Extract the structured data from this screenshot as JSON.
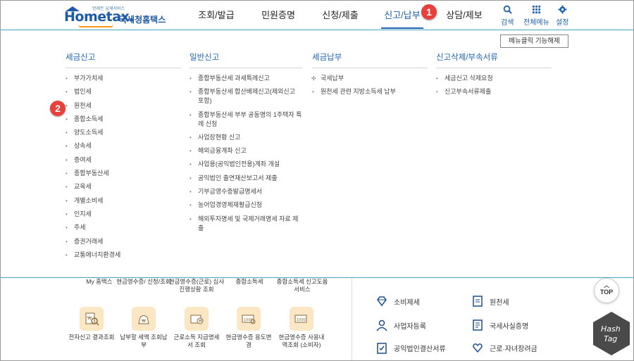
{
  "header": {
    "logo_tagline": "언제든 납세서비스",
    "logo_word": "Hometax.",
    "logo_korean": "국세청홈택스",
    "gnb": [
      "조회/발급",
      "민원증명",
      "신청/제출",
      "신고/납부",
      "상담/제보"
    ],
    "active_gnb": "신고/납부",
    "util": {
      "search": "검색",
      "all_menu": "전체메뉴",
      "settings": "설정"
    }
  },
  "markers": {
    "m1": "1",
    "m2": "2"
  },
  "mega_menu": {
    "unlock_button": "메뉴클릭 기능해제",
    "columns": [
      {
        "title": "세금신고",
        "items": [
          "부가가치세",
          "법인세",
          "원천세",
          "종합소득세",
          "양도소득세",
          "상속세",
          "증여세",
          "종합부동산세",
          "교육세",
          "개별소비세",
          "인지세",
          "주세",
          "증권거래세",
          "교통에너지환경세"
        ]
      },
      {
        "title": "일반신고",
        "items": [
          "종합부동산세 과세특례신고",
          "종합부동산세 합산배제신고(제외신고 포함)",
          "종합부동산세 부부 공동명의 1주택자 특례 신청",
          "사업장현황 신고",
          "해외금융계좌 신고",
          "사업용(공익법인전용)계좌 개설",
          "공익법인 출연재산보고서 제출",
          "기부금영수증발급명세서",
          "농어업경영체재활급신청",
          "해외투자명세 및 국제거래명세 자료 제출"
        ]
      },
      {
        "title": "세금납부",
        "items": [
          "국세납부",
          "원천세 관련 지방소득세 납부"
        ]
      },
      {
        "title": "신고삭제/부속서류",
        "items": [
          "세금신고 삭제요청",
          "신고부속서류제출"
        ]
      }
    ]
  },
  "background": {
    "cut_labels": [
      "My 홈택스",
      "현금영수증/ 신청/조회",
      "현금영수증(근로) 심사진행상황 조회",
      "종합소득세",
      "종합소득세 신고도움 서비스"
    ],
    "quick_icons": [
      "전자신고 결과조회",
      "납부할 세액 조회납부",
      "근로소득 지급명세서 조회",
      "현금영수증 용도변경",
      "현금영수증 사용내역조회 (소비자)"
    ],
    "services_left": [
      "소비제세",
      "사업자등록",
      "공익법인결산서류"
    ],
    "services_right": [
      "원천세",
      "국세사실증명",
      "근로·자녀장려금"
    ],
    "top_button": "TOP",
    "hashtag_top": "Hash",
    "hashtag_bottom": "Tag"
  },
  "colors": {
    "brand": "#1d62b3",
    "marker": "#e8413c",
    "quick_bg": "#fbe7c4"
  }
}
